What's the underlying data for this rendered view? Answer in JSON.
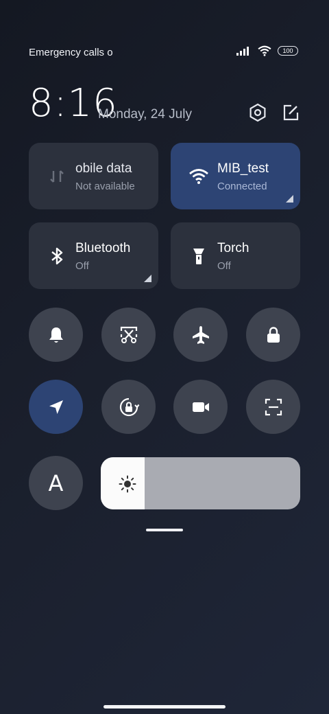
{
  "status_bar": {
    "text": "Emergency calls o",
    "battery": "100"
  },
  "header": {
    "time": "8:16",
    "date": "Monday, 24 July",
    "settings_icon": "hexagon-settings-icon",
    "edit_icon": "edit-icon"
  },
  "tiles": {
    "mobile_data": {
      "title": "obile data",
      "status": "Not available",
      "icon": "mobile-data-arrows-icon"
    },
    "wifi": {
      "title": "MIB_test",
      "status": "Connected",
      "icon": "wifi-icon"
    },
    "bluetooth": {
      "title": "Bluetooth",
      "status": "Off",
      "icon": "bluetooth-icon"
    },
    "torch": {
      "title": "Torch",
      "status": "Off",
      "icon": "torch-icon"
    }
  },
  "toggles": [
    {
      "name": "bell-icon",
      "active": false
    },
    {
      "name": "screenshot-scissors-icon",
      "active": false
    },
    {
      "name": "airplane-icon",
      "active": false
    },
    {
      "name": "lock-icon",
      "active": false
    },
    {
      "name": "location-icon",
      "active": true
    },
    {
      "name": "rotation-lock-icon",
      "active": false
    },
    {
      "name": "video-camera-icon",
      "active": false
    },
    {
      "name": "scan-icon",
      "active": false
    }
  ],
  "auto_brightness": {
    "label": "A"
  },
  "brightness": {
    "level": 0.22
  },
  "colors": {
    "background": "#1a1f2c",
    "tile": "#2c313d",
    "active": "#2d4474",
    "circle": "#3e434f"
  }
}
